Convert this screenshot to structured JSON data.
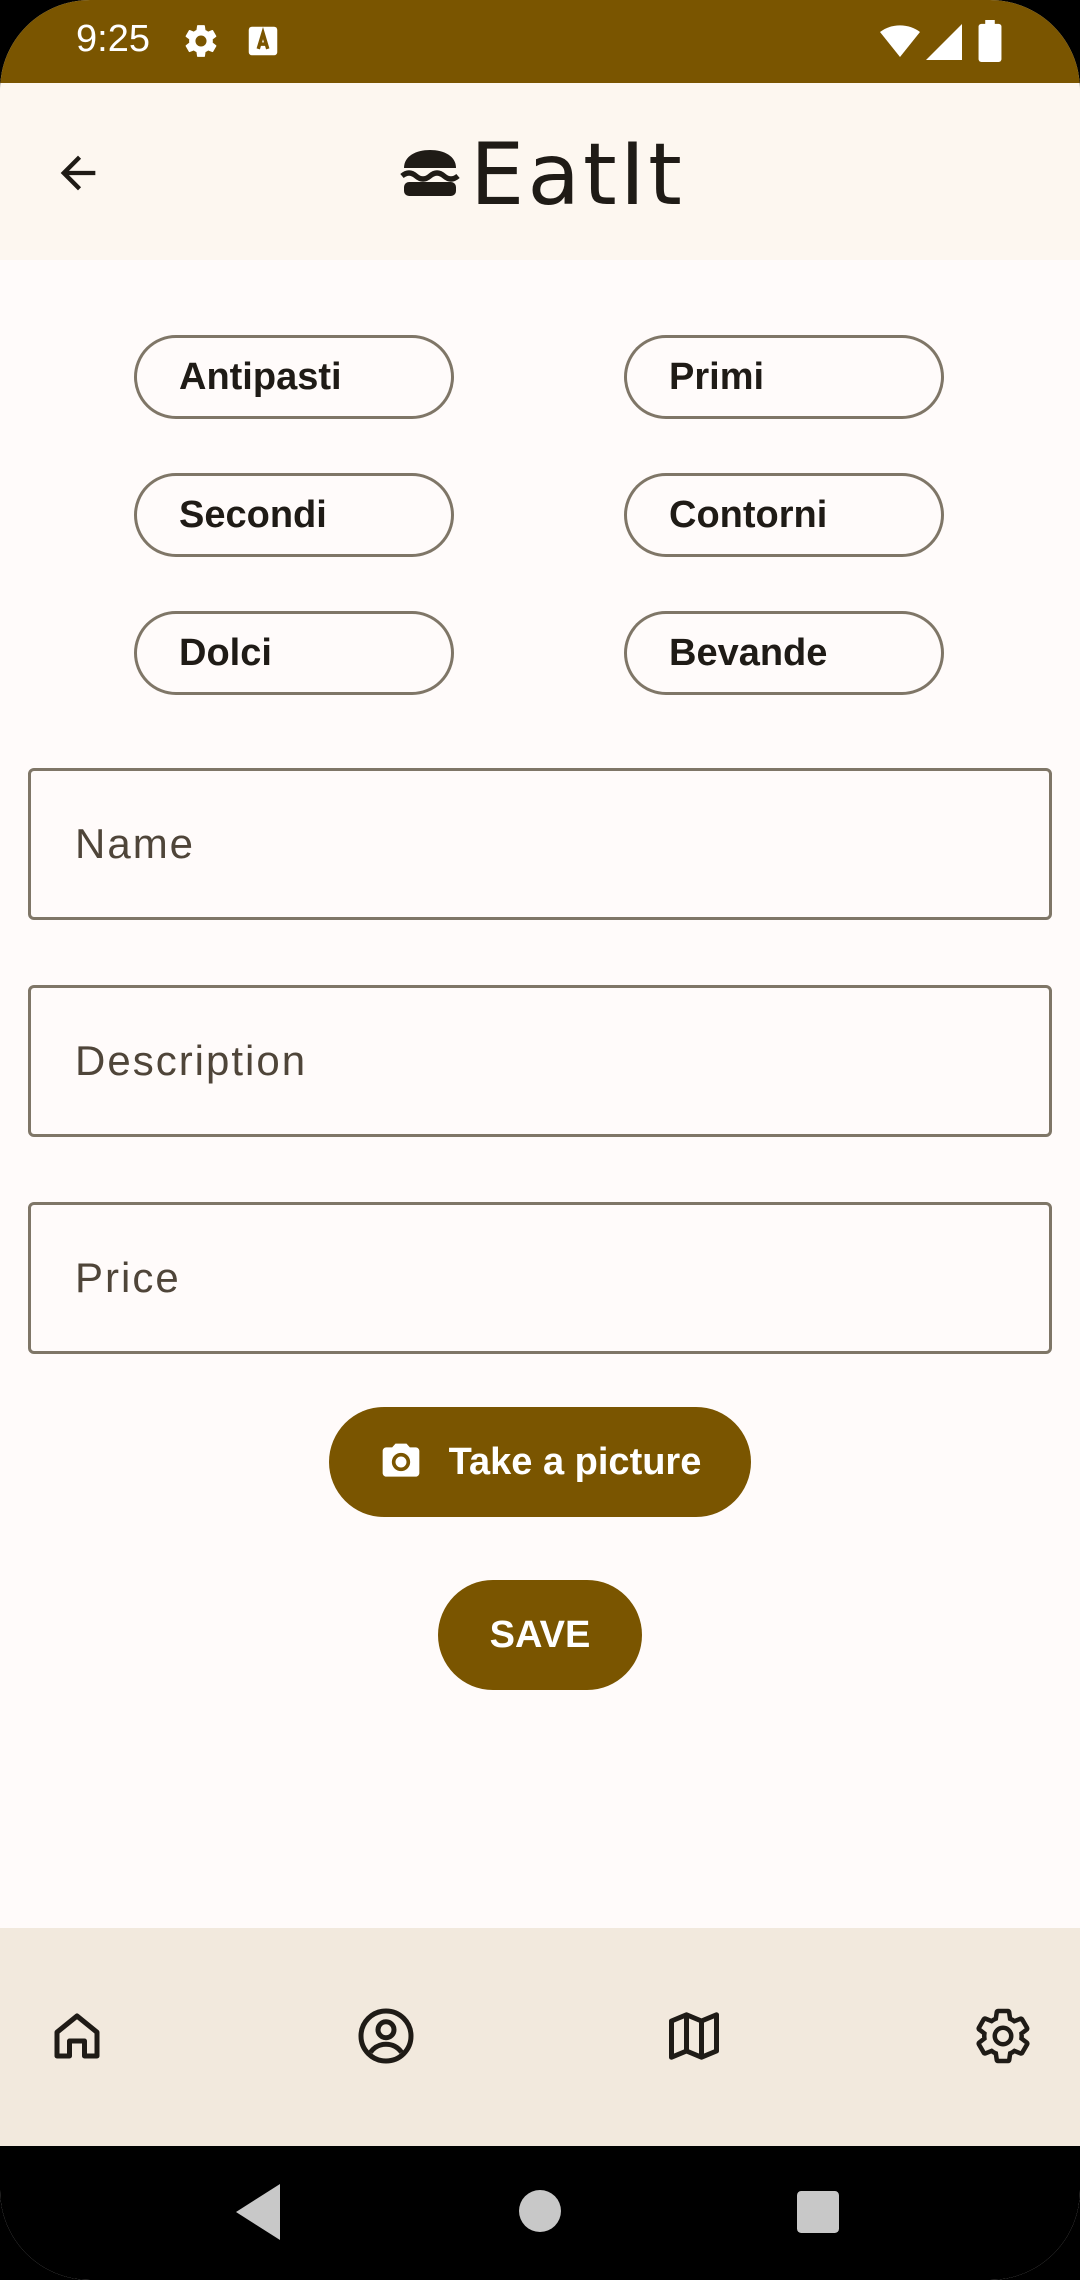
{
  "status_bar": {
    "time": "9:25",
    "icons": [
      "settings-icon",
      "text-a-icon",
      "wifi-icon",
      "signal-icon",
      "battery-icon"
    ]
  },
  "app_bar": {
    "title": "EatIt",
    "back_icon": "arrow-back-icon",
    "logo_icon": "burger-icon"
  },
  "categories": [
    "Antipasti",
    "Primi",
    "Secondi",
    "Contorni",
    "Dolci",
    "Bevande"
  ],
  "form": {
    "name_placeholder": "Name",
    "description_placeholder": "Description",
    "price_placeholder": "Price",
    "take_picture_label": "Take a picture",
    "save_label": "SAVE"
  },
  "bottom_nav": {
    "items": [
      "home-icon",
      "account-icon",
      "map-icon",
      "settings-icon"
    ]
  },
  "colors": {
    "primary": "#7a5500",
    "app_bar_bg": "#fdf7f0",
    "bottom_nav_bg": "#f2e9dd",
    "outline": "#7f7667"
  }
}
